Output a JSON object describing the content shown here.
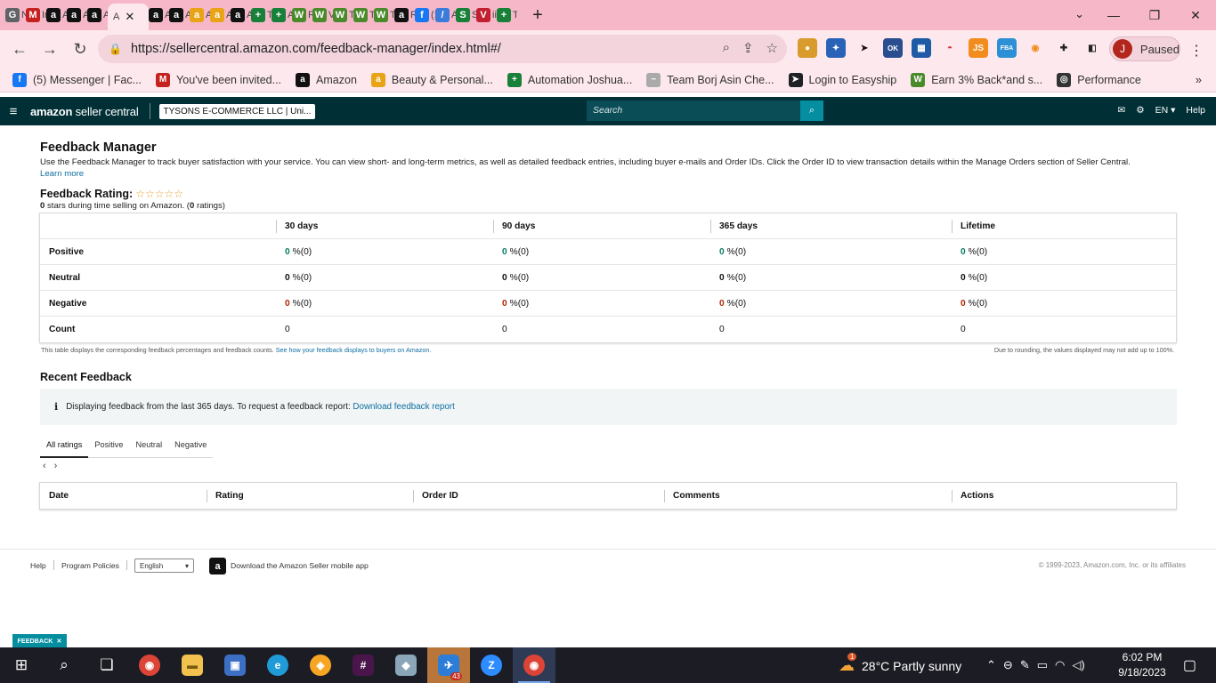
{
  "browser": {
    "tabs": [
      {
        "icon": "G",
        "label": "N",
        "color": "#5f6368"
      },
      {
        "icon": "M",
        "label": "Ir",
        "color": "#c5221f"
      },
      {
        "icon": "a",
        "label": "A",
        "color": "#111111"
      },
      {
        "icon": "a",
        "label": "A",
        "color": "#111111"
      },
      {
        "icon": "a",
        "label": "A",
        "color": "#111111"
      },
      {
        "icon": "a",
        "label": "A",
        "color": "#111111"
      },
      {
        "icon": "a",
        "label": "A",
        "color": "#111111"
      },
      {
        "icon": "a",
        "label": "A",
        "color": "#e8a317"
      },
      {
        "icon": "a",
        "label": "A",
        "color": "#e8a317"
      },
      {
        "icon": "a",
        "label": "A",
        "color": "#111111"
      },
      {
        "icon": "+",
        "label": "T",
        "color": "#188038"
      },
      {
        "icon": "+",
        "label": "A",
        "color": "#188038"
      },
      {
        "icon": "W",
        "label": "R",
        "color": "#4a8a2b"
      },
      {
        "icon": "W",
        "label": "V",
        "color": "#4a8a2b"
      },
      {
        "icon": "W",
        "label": "T",
        "color": "#4a8a2b"
      },
      {
        "icon": "W",
        "label": "T",
        "color": "#4a8a2b"
      },
      {
        "icon": "W",
        "label": "T",
        "color": "#4a8a2b"
      },
      {
        "icon": "a",
        "label": "R",
        "color": "#111111"
      },
      {
        "icon": "f",
        "label": "(:",
        "color": "#1877f2"
      },
      {
        "icon": "/",
        "label": "A",
        "color": "#3d7bdb"
      },
      {
        "icon": "S",
        "label": "S",
        "color": "#188038"
      },
      {
        "icon": "V",
        "label": "ii",
        "color": "#c21f30"
      },
      {
        "icon": "+",
        "label": "T",
        "color": "#188038"
      }
    ],
    "active_tab": {
      "label": "A",
      "close": "✕"
    },
    "new_tab": "+",
    "url": "https://sellercentral.amazon.com/feedback-manager/index.html#/",
    "profile_initial": "J",
    "profile_label": "Paused",
    "ext_ok": "OK",
    "ext_js": "JS",
    "ext_fba": "FBA",
    "bookmarks": [
      {
        "label": "(5) Messenger | Fac...",
        "icon": "f",
        "color": "#1877f2"
      },
      {
        "label": "You've been invited...",
        "icon": "M",
        "color": "#c5221f"
      },
      {
        "label": "Amazon",
        "icon": "a",
        "color": "#111111"
      },
      {
        "label": "Beauty & Personal...",
        "icon": "a",
        "color": "#e8a317"
      },
      {
        "label": "Automation Joshua...",
        "icon": "+",
        "color": "#188038"
      },
      {
        "label": "Team Borj Asin Che...",
        "icon": "~",
        "color": "#aaaaaa"
      },
      {
        "label": "Login to Easyship",
        "icon": "➤",
        "color": "#202124"
      },
      {
        "label": "Earn 3% Back*and s...",
        "icon": "W",
        "color": "#4a8a2b"
      },
      {
        "label": "Performance",
        "icon": "◎",
        "color": "#333333"
      }
    ],
    "bookmarks_more": "»"
  },
  "seller_header": {
    "logo_bold": "amazon",
    "logo_rest": " seller central",
    "store": "TYSONS E-COMMERCE LLC | Uni...",
    "search_placeholder": "Search",
    "lang": "EN ▾",
    "help": "Help"
  },
  "page": {
    "title": "Feedback Manager",
    "intro": "Use the Feedback Manager to track buyer satisfaction with your service. You can view short- and long-term metrics, as well as detailed feedback entries, including buyer e-mails and Order IDs. Click the Order ID to view transaction details within the Manage Orders section of Seller Central.",
    "learn_more": "Learn more",
    "rating_label": "Feedback Rating:",
    "stars": "☆☆☆☆☆",
    "rating_stars_value": "0",
    "rating_sub_text": " stars during time selling on Amazon. (",
    "rating_count": "0",
    "rating_sub_end": " ratings)",
    "columns": [
      "",
      "30 days",
      "90 days",
      "365 days",
      "Lifetime"
    ],
    "rows": [
      {
        "label": "Positive",
        "kind": "green",
        "cells": [
          {
            "n": "0",
            "t": "%(0)"
          },
          {
            "n": "0",
            "t": "%(0)"
          },
          {
            "n": "0",
            "t": "%(0)"
          },
          {
            "n": "0",
            "t": "%(0)"
          }
        ]
      },
      {
        "label": "Neutral",
        "kind": "plain",
        "cells": [
          {
            "n": "0",
            "t": "%(0)"
          },
          {
            "n": "0",
            "t": "%(0)"
          },
          {
            "n": "0",
            "t": "%(0)"
          },
          {
            "n": "0",
            "t": "%(0)"
          }
        ]
      },
      {
        "label": "Negative",
        "kind": "red",
        "cells": [
          {
            "n": "0",
            "t": "%(0)"
          },
          {
            "n": "0",
            "t": "%(0)"
          },
          {
            "n": "0",
            "t": "%(0)"
          },
          {
            "n": "0",
            "t": "%(0)"
          }
        ]
      },
      {
        "label": "Count",
        "kind": "count",
        "cells": [
          {
            "n": "",
            "t": "0"
          },
          {
            "n": "",
            "t": "0"
          },
          {
            "n": "",
            "t": "0"
          },
          {
            "n": "",
            "t": "0"
          }
        ]
      }
    ],
    "table_note": "This table displays the corresponding feedback percentages and feedback counts.",
    "table_note_link": "See how your feedback displays to buyers on Amazon.",
    "rounding_note": "Due to rounding, the values displayed may not add up to 100%.",
    "recent_title": "Recent Feedback",
    "info_icon": "i",
    "info_text": "Displaying feedback from the last 365 days. To request a feedback report:",
    "info_link": "Download feedback report",
    "rating_tabs": [
      "All ratings",
      "Positive",
      "Neutral",
      "Negative"
    ],
    "pager_prev": "‹",
    "pager_next": "›",
    "recent_columns": [
      "Date",
      "Rating",
      "Order ID",
      "Comments",
      "Actions"
    ]
  },
  "footer": {
    "help": "Help",
    "policies": "Program Policies",
    "language": "English",
    "app_icon": "a",
    "app_text": "Download the Amazon Seller mobile app",
    "copyright": "© 1999-2023, Amazon.com, Inc. or its affiliates",
    "feedback_tab": "FEEDBACK"
  },
  "taskbar": {
    "weather_badge": "1",
    "weather": "28°C  Partly sunny",
    "time": "6:02 PM",
    "date": "9/18/2023",
    "mail_badge": "43",
    "zoom": "Z"
  }
}
